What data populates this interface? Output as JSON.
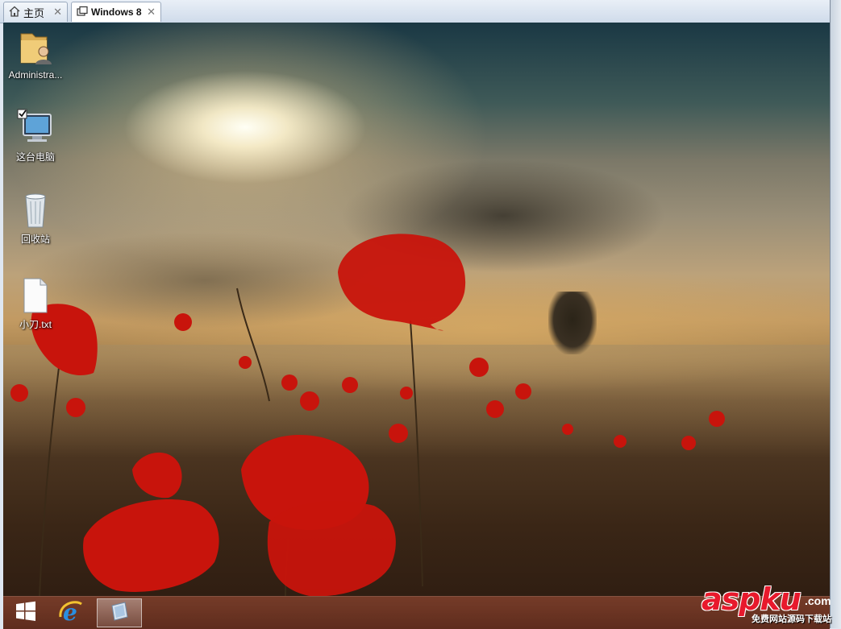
{
  "tabs": [
    {
      "label": "主页",
      "icon": "home-icon"
    },
    {
      "label": "Windows 8",
      "icon": "vm-icon",
      "active": true
    }
  ],
  "desktop_icons": [
    {
      "label": "Administra...",
      "icon": "user-folder-icon"
    },
    {
      "label": "这台电脑",
      "icon": "computer-icon"
    },
    {
      "label": "回收站",
      "icon": "recycle-bin-icon"
    },
    {
      "label": "小刀.txt",
      "icon": "text-file-icon"
    }
  ],
  "taskbar": {
    "items": [
      {
        "name": "start-button",
        "icon": "windows-logo-icon"
      },
      {
        "name": "internet-explorer",
        "icon": "ie-icon"
      },
      {
        "name": "active-app",
        "icon": "app-icon",
        "active": true
      }
    ]
  },
  "watermark": {
    "brand": "aspku",
    "suffix": ".com",
    "tagline": "免费网站源码下载站"
  },
  "colors": {
    "taskbar": "#6e321e",
    "tab_bar": "#dce5f0",
    "watermark_red": "#e8192c"
  }
}
